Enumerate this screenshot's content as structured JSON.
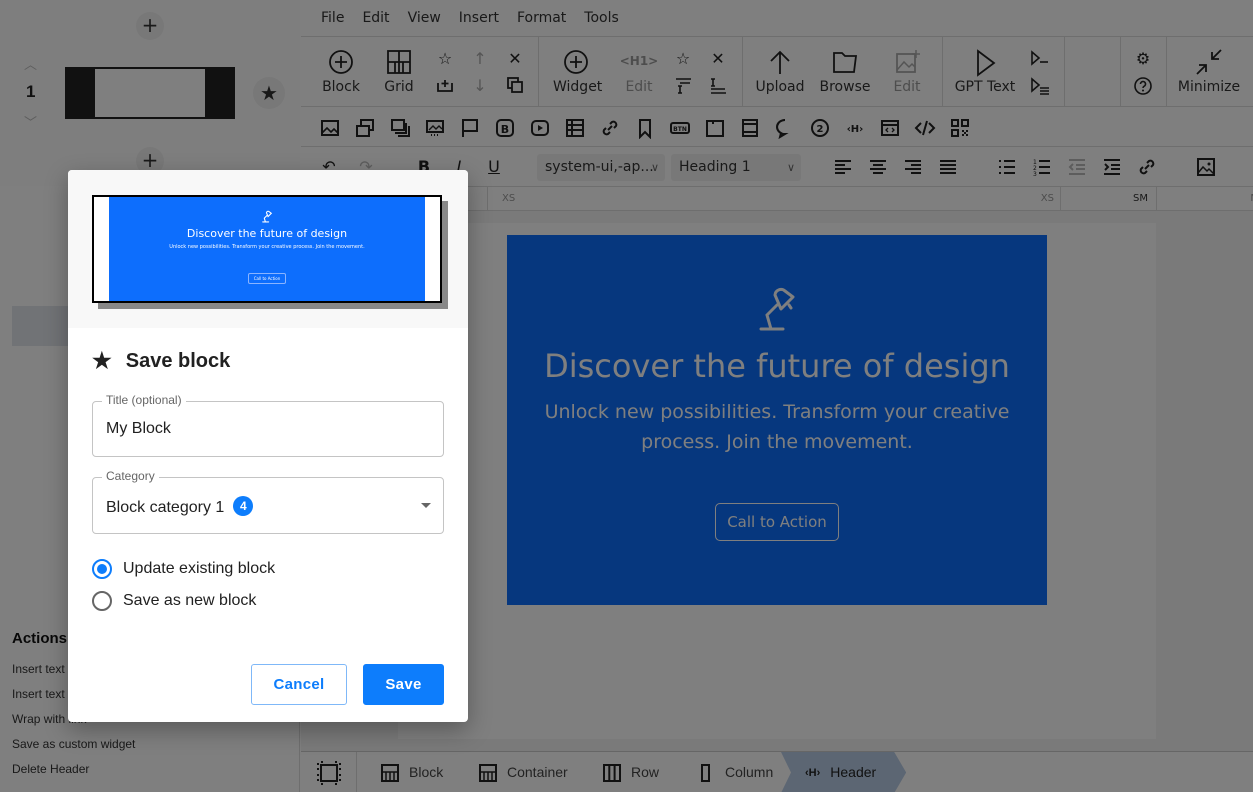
{
  "sidebar": {
    "slide_number": "1",
    "add_above_label": "+",
    "add_below_label": "+",
    "actions_title": "Actions",
    "actions": [
      "Insert text",
      "Insert text",
      "Wrap with link",
      "Save as custom widget",
      "Delete Header"
    ]
  },
  "menubar": [
    "File",
    "Edit",
    "View",
    "Insert",
    "Format",
    "Tools"
  ],
  "toolbar": {
    "block_label": "Block",
    "grid_label": "Grid",
    "widget_label": "Widget",
    "widget_edit_label": "Edit",
    "upload_label": "Upload",
    "browse_label": "Browse",
    "image_edit_label": "Edit",
    "gpt_text_label": "GPT Text",
    "minimize_label": "Minimize"
  },
  "format_bar": {
    "font_family": "system-ui,-ap...",
    "block_style": "Heading 1"
  },
  "ruler": {
    "labels": [
      "XS",
      "XS",
      "SM",
      "M"
    ]
  },
  "canvas": {
    "hero_title": "Discover the future of design",
    "hero_text": "Unlock new possibilities. Transform your creative process. Join the movement.",
    "cta_label": "Call to Action",
    "hero_color": "#0d6efd"
  },
  "breadcrumb": {
    "items": [
      "Block",
      "Container",
      "Row",
      "Column",
      "Header"
    ],
    "active": "Header"
  },
  "modal": {
    "title": "Save block",
    "preview": {
      "title": "Discover the future of design",
      "text": "Unlock new possibilities. Transform your creative process. Join the movement.",
      "cta": "Call to Action"
    },
    "title_field": {
      "label": "Title (optional)",
      "value": "My Block"
    },
    "category_field": {
      "label": "Category",
      "value": "Block category 1",
      "badge": "4"
    },
    "options": [
      {
        "label": "Update existing block",
        "checked": true
      },
      {
        "label": "Save as new block",
        "checked": false
      }
    ],
    "cancel_label": "Cancel",
    "save_label": "Save",
    "accent_color": "#0d7dfc"
  }
}
